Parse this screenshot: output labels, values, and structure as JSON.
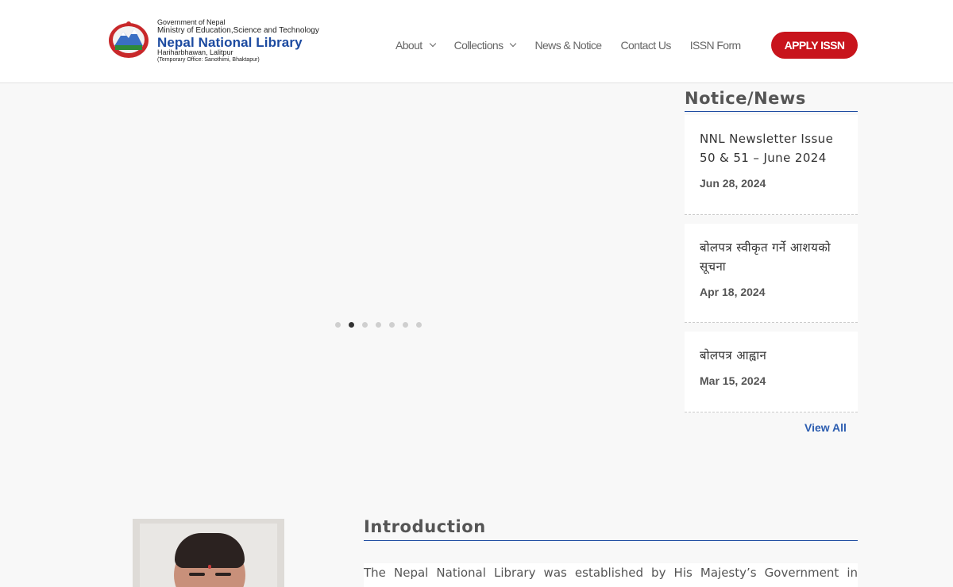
{
  "header": {
    "logo": {
      "line1": "Government of Nepal",
      "line2": "Ministry of Education,Science and Technology",
      "name": "Nepal National Library",
      "address": "Hariharbhawan, Lalitpur",
      "temp_office": "(Temporary Office: Sanothimi, Bhaktapur)"
    },
    "nav": [
      {
        "label": "About",
        "has_dropdown": true
      },
      {
        "label": "Collections",
        "has_dropdown": true
      },
      {
        "label": "News & Notice",
        "has_dropdown": false
      },
      {
        "label": "Contact Us",
        "has_dropdown": false
      },
      {
        "label": "ISSN Form",
        "has_dropdown": false
      }
    ],
    "apply_button": "APPLY ISSN"
  },
  "slider": {
    "dot_count": 7,
    "active_index": 1
  },
  "notice": {
    "title": "Notice/News",
    "items": [
      {
        "title": "NNL Newsletter Issue 50 & 51 – June 2024",
        "date": "Jun 28, 2024"
      },
      {
        "title": "बोलपत्र स्वीकृत गर्ने आशयको सूचना",
        "date": "Apr 18, 2024"
      },
      {
        "title": "बोलपत्र आह्वान",
        "date": "Mar 15, 2024"
      }
    ],
    "view_all": "View All"
  },
  "introduction": {
    "title": "Introduction",
    "text": "The Nepal National Library was established by His Majesty’s Government in January"
  },
  "colors": {
    "accent_red": "#c8141c",
    "brand_blue": "#1c4aa0",
    "link_blue": "#2c5db0"
  }
}
